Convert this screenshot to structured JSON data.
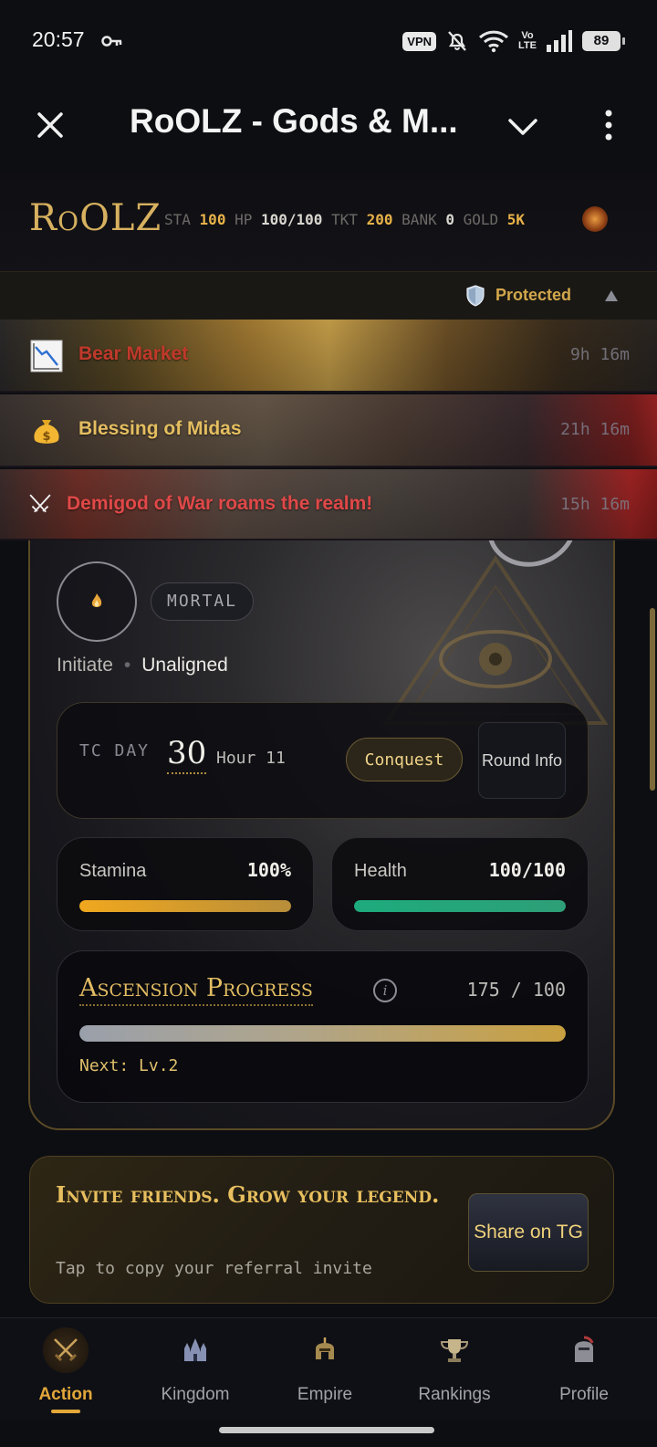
{
  "status_bar": {
    "time": "20:57",
    "vpn": "VPN",
    "volte_top": "Vo",
    "volte_bottom": "LTE",
    "battery": "89"
  },
  "app_bar": {
    "title": "RoOLZ - Gods & M..."
  },
  "game_header": {
    "logo": "RoOLZ",
    "stats": [
      {
        "label": "STA",
        "value": "100"
      },
      {
        "label": "HP",
        "value": "100/100"
      },
      {
        "label": "TKT",
        "value": "200"
      },
      {
        "label": "BANK",
        "value": "0"
      },
      {
        "label": "GOLD",
        "value": "5K"
      }
    ]
  },
  "protected": {
    "label": "Protected"
  },
  "events": [
    {
      "name": "Bear Market",
      "timer": "9h 16m",
      "color": "#c0392b"
    },
    {
      "name": "Blessing of Midas",
      "timer": "21h 16m",
      "color": "#e4be60"
    },
    {
      "name": "Demigod of War roams the realm!",
      "timer": "15h 16m",
      "color": "#e04848"
    }
  ],
  "player": {
    "rank": "MORTAL",
    "title": "Initiate",
    "alignment": "Unaligned"
  },
  "round": {
    "prefix": "TC DAY",
    "day": "30",
    "hour": "Hour 11",
    "conquest_label": "Conquest",
    "round_info_label": "Round Info"
  },
  "stamina": {
    "label": "Stamina",
    "value": "100%",
    "fraction": 1.0
  },
  "health": {
    "label": "Health",
    "value": "100/100",
    "fraction": 1.0
  },
  "ascension": {
    "title": "Ascension Progress",
    "info": "i",
    "count": "175 / 100",
    "fraction": 1.0,
    "next": "Next: Lv.2"
  },
  "invite": {
    "title": "Invite friends. Grow your legend.",
    "subtitle": "Tap to copy your referral invite",
    "share_label": "Share on TG"
  },
  "nav": [
    {
      "label": "Action",
      "icon": "crossed-swords-icon",
      "active": true
    },
    {
      "label": "Kingdom",
      "icon": "castle-icon",
      "active": false
    },
    {
      "label": "Empire",
      "icon": "helmet-icon",
      "active": false
    },
    {
      "label": "Rankings",
      "icon": "trophy-icon",
      "active": false
    },
    {
      "label": "Profile",
      "icon": "knight-icon",
      "active": false
    }
  ]
}
